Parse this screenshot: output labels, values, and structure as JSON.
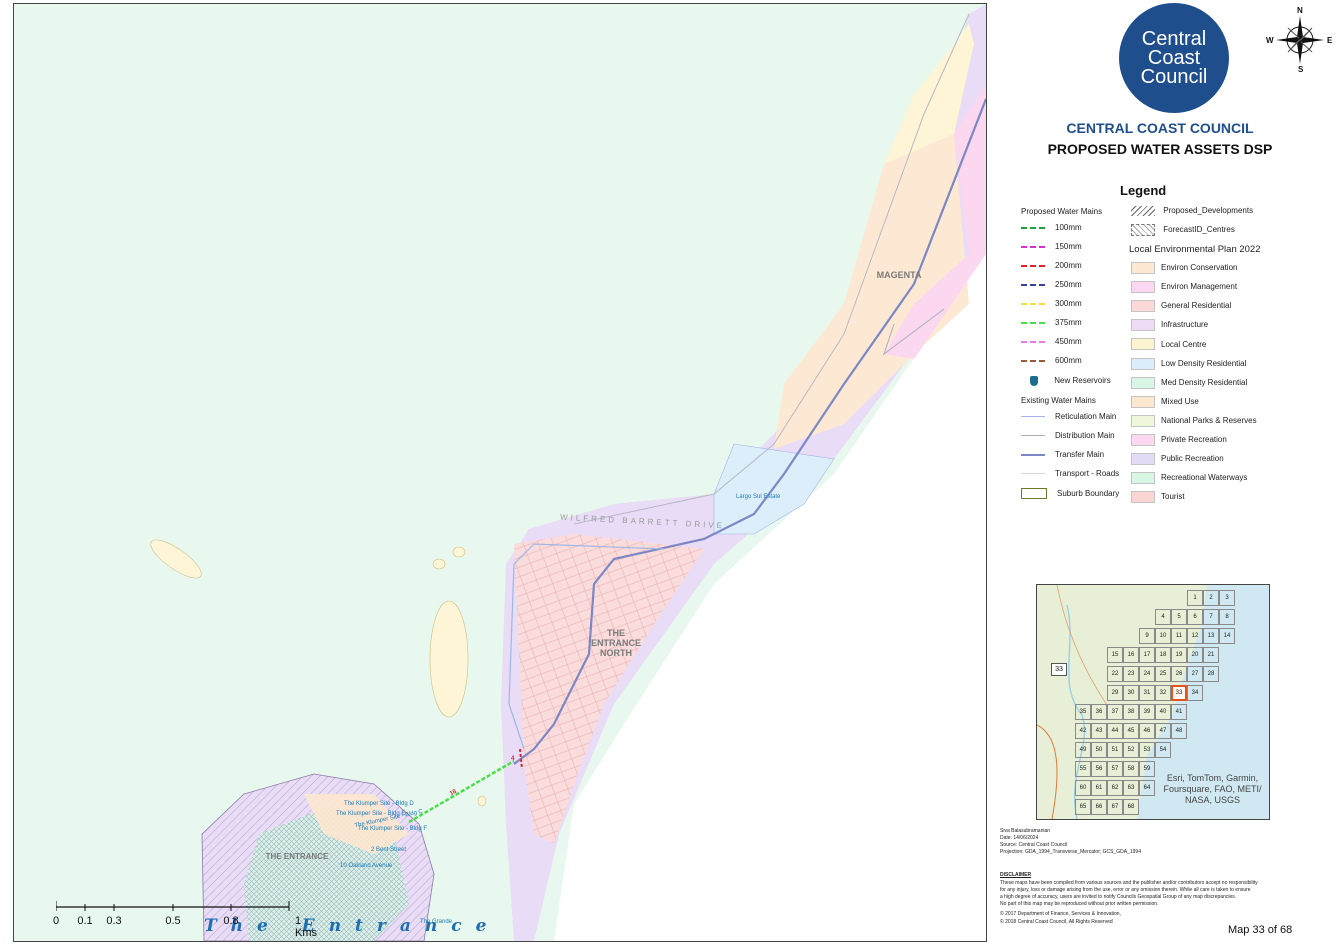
{
  "map": {
    "places": {
      "magenta": "MAGENTA",
      "entrance_north": "THE ENTRANCE NORTH",
      "entrance": "THE ENTRANCE",
      "road": "WILFRED BARRETT DRIVE",
      "water_name": "The Entrance"
    },
    "sites": {
      "largo": "Largo Sul Estate",
      "klumper_d": "The Klumper Site - Bldg D",
      "klumper_e": "The Klumper Site - Bldg E",
      "klumper_c": "The Klumper Site - Bldg C",
      "klumper_f": "The Klumper Site - Bldg F",
      "bent_street": "2 Bent Street",
      "oakland": "10 Oakland Avenue",
      "grande": "The Grande"
    },
    "main_labels": {
      "a": "16",
      "b": "4"
    },
    "scale": {
      "ticks": [
        "0",
        "0.1",
        "0.3",
        "0.5",
        "0.8",
        "1 Kms"
      ]
    },
    "colors": {
      "sea": "#e8f8ee",
      "public_recreation": "#e9dcf6",
      "private_recreation": "#fcd7f0",
      "low_density": "#ddeefb",
      "environ_conservation": "#fde9d3",
      "local_centre": "#fdf5d5",
      "general_residential": "#fbdcdc",
      "transfer_main": "#7b88c4"
    }
  },
  "logo": {
    "line1": "Central",
    "line2": "Coast",
    "line3": "Council"
  },
  "compass": {
    "n": "N",
    "s": "S",
    "e": "E",
    "w": "W"
  },
  "titles": {
    "council": "CENTRAL COAST COUNCIL",
    "map": "PROPOSED WATER ASSETS DSP"
  },
  "legend": {
    "title": "Legend",
    "proposed_header": "Proposed Water Mains",
    "proposed": [
      {
        "label": "100mm",
        "color": "#1f9e3a"
      },
      {
        "label": "150mm",
        "color": "#d62fd6"
      },
      {
        "label": "200mm",
        "color": "#e0222a"
      },
      {
        "label": "250mm",
        "color": "#3b3f9e"
      },
      {
        "label": "300mm",
        "color": "#e8e23a"
      },
      {
        "label": "375mm",
        "color": "#46e046"
      },
      {
        "label": "450mm",
        "color": "#e67ae6"
      },
      {
        "label": "600mm",
        "color": "#9a5a3a"
      }
    ],
    "reservoirs": "New Reservoirs",
    "existing_header": "Existing Water Mains",
    "existing": [
      {
        "label": "Reticulation Main",
        "color": "#9fb6e6"
      },
      {
        "label": "Distribution Main",
        "color": "#a9aebd"
      },
      {
        "label": "Transfer Main",
        "color": "#7b88c4"
      },
      {
        "label": "Transport - Roads",
        "color": "#d8d8d8"
      },
      {
        "label": "Suburb Boundary",
        "color": "#6a7a2a"
      }
    ],
    "developments": "Proposed_Developments",
    "forecast": "ForecastID_Centres",
    "lep_header": "Local Environmental Plan 2022",
    "lep": [
      {
        "label": "Environ Conservation",
        "color": "#fde9d3"
      },
      {
        "label": "Environ Management",
        "color": "#fdd7f2"
      },
      {
        "label": "General Residential",
        "color": "#fbd9d9"
      },
      {
        "label": "Infrastructure",
        "color": "#eedcf7"
      },
      {
        "label": "Local Centre",
        "color": "#fdf3cf"
      },
      {
        "label": "Low Density Residential",
        "color": "#dcecfa"
      },
      {
        "label": "Med Density Residential",
        "color": "#d9f5e6"
      },
      {
        "label": "Mixed Use",
        "color": "#fde7cf"
      },
      {
        "label": "National Parks & Reserves",
        "color": "#eef7d9"
      },
      {
        "label": "Private Recreation",
        "color": "#fcd7f0"
      },
      {
        "label": "Public Recreation",
        "color": "#e4dbf6"
      },
      {
        "label": "Recreational Waterways",
        "color": "#d8f6e4"
      },
      {
        "label": "Tourist",
        "color": "#fbd4d4"
      }
    ]
  },
  "inset": {
    "road_shield": "33",
    "credit": "Esri, TomTom, Garmin, Foursquare, FAO, METI/ NASA, USGS",
    "cells": [
      "1",
      "2",
      "3",
      "4",
      "5",
      "6",
      "7",
      "8",
      "9",
      "10",
      "11",
      "12",
      "13",
      "14",
      "15",
      "16",
      "17",
      "18",
      "19",
      "20",
      "21",
      "22",
      "23",
      "24",
      "25",
      "26",
      "27",
      "28",
      "29",
      "30",
      "31",
      "32",
      "33",
      "34",
      "35",
      "36",
      "37",
      "38",
      "39",
      "40",
      "41",
      "42",
      "43",
      "44",
      "45",
      "46",
      "47",
      "48",
      "49",
      "50",
      "51",
      "52",
      "53",
      "54",
      "55",
      "56",
      "57",
      "58",
      "59",
      "60",
      "61",
      "62",
      "63",
      "64",
      "65",
      "66",
      "67",
      "68"
    ],
    "highlight": "33"
  },
  "meta": {
    "author": "Siva Balasubramanian",
    "date": "Date: 14/06/2024",
    "source": "Source: Central Coast Council",
    "projection": "Projection: GDA_1994_Transverse_Mercator; GCS_GDA_1994",
    "disclaimer_title": "DISCLAIMER",
    "disclaimer_1": "These maps have been compiled from various sources and the publisher and/or contributors accept no responsibility",
    "disclaimer_2": "for any injury, loss or damage arising from the use, error or any omission therein. While all care is taken to ensure",
    "disclaimer_3": "a high degree of accuracy, users are invited to notify Councils Geospatial Group of any map discrepancies.",
    "disclaimer_4": "No part of this map may be reproduced without prior written permission.",
    "copyright_1": "© 2017 Department of Finance, Services & Innovation,",
    "copyright_2": "© 2018 Central Coast Council, All Rights Reserved"
  },
  "map_number": "Map 33 of 68"
}
